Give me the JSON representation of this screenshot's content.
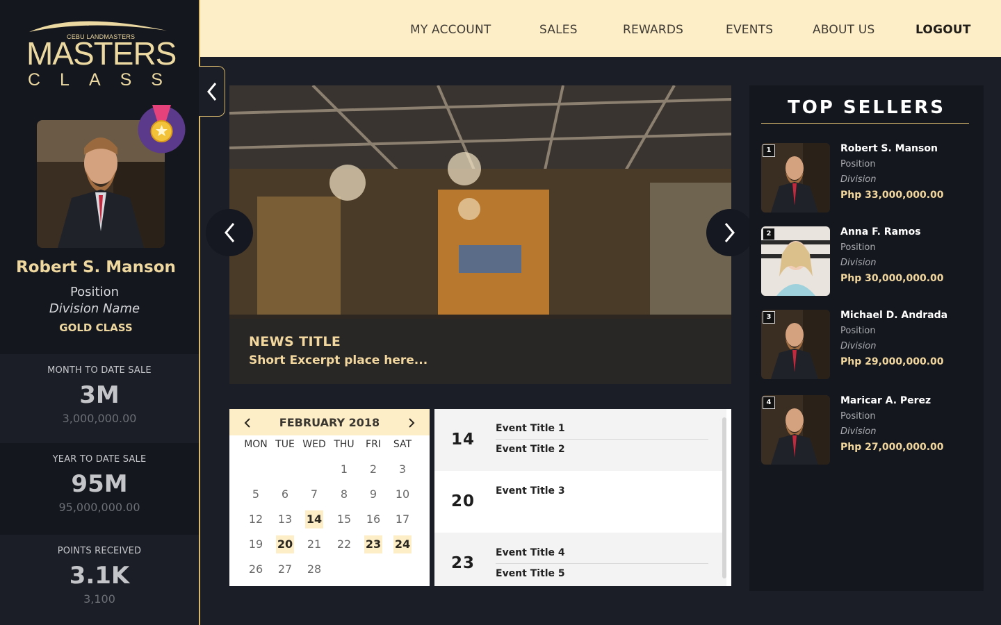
{
  "brand": {
    "subtitle": "CEBU LANDMASTERS",
    "title": "MASTERS",
    "title_class": "CLASS"
  },
  "nav": [
    "MY ACCOUNT",
    "SALES",
    "REWARDS",
    "EVENTS",
    "ABOUT US"
  ],
  "logout_label": "LOGOUT",
  "profile": {
    "name": "Robert S. Manson",
    "position": "Position",
    "division": "Division Name",
    "class": "GOLD CLASS"
  },
  "stats": [
    {
      "title": "MONTH TO DATE SALE",
      "big": "3M",
      "small": "3,000,000.00"
    },
    {
      "title": "YEAR TO DATE SALE",
      "big": "95M",
      "small": "95,000,000.00"
    },
    {
      "title": "POINTS RECEIVED",
      "big": "3.1K",
      "small": "3,100"
    }
  ],
  "news": {
    "title": "NEWS TITLE",
    "excerpt": "Short Excerpt place here..."
  },
  "calendar": {
    "month_label": "FEBRUARY 2018",
    "weekdays": [
      "MON",
      "TUE",
      "WED",
      "THU",
      "FRI",
      "SAT"
    ],
    "weeks": [
      [
        "",
        "",
        "",
        "1",
        "2",
        "3"
      ],
      [
        "5",
        "6",
        "7",
        "8",
        "9",
        "10"
      ],
      [
        "12",
        "13",
        "14",
        "15",
        "16",
        "17"
      ],
      [
        "19",
        "20",
        "21",
        "22",
        "23",
        "24"
      ],
      [
        "26",
        "27",
        "28",
        "",
        "",
        ""
      ]
    ],
    "highlighted": [
      "14",
      "20",
      "23",
      "24"
    ]
  },
  "events": [
    {
      "date": "14",
      "titles": [
        "Event Title 1",
        "Event Title 2"
      ]
    },
    {
      "date": "20",
      "titles": [
        "Event Title 3"
      ]
    },
    {
      "date": "23",
      "titles": [
        "Event Title 4",
        "Event Title 5"
      ]
    }
  ],
  "top_sellers": {
    "title": "TOP SELLERS",
    "items": [
      {
        "rank": "1",
        "name": "Robert S. Manson",
        "position": "Position",
        "division": "Division",
        "sales": "Php 33,000,000.00"
      },
      {
        "rank": "2",
        "name": "Anna F. Ramos",
        "position": "Position",
        "division": "Division",
        "sales": "Php 30,000,000.00"
      },
      {
        "rank": "3",
        "name": "Michael D. Andrada",
        "position": "Position",
        "division": "Division",
        "sales": "Php 29,000,000.00"
      },
      {
        "rank": "4",
        "name": "Maricar A. Perez",
        "position": "Position",
        "division": "Division",
        "sales": "Php 27,000,000.00"
      }
    ]
  },
  "colors": {
    "gold": "#d9b96e",
    "cream": "#fdeec7",
    "dark": "#14171e",
    "accent_text": "#f2d79f"
  }
}
